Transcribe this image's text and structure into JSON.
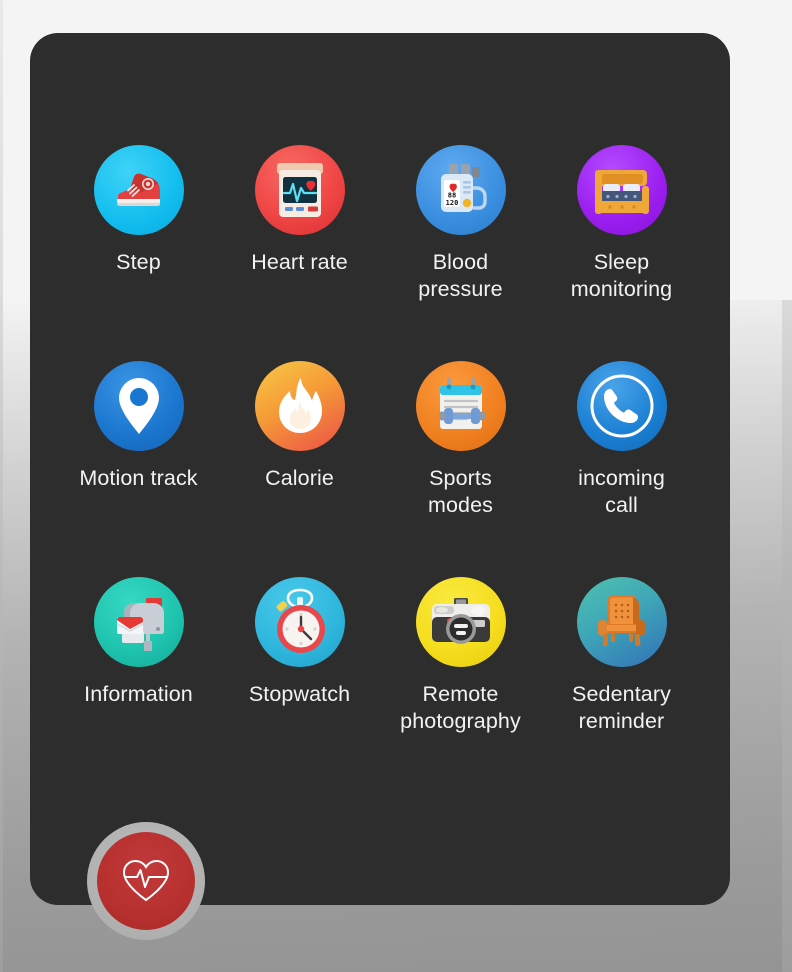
{
  "screen": {
    "background_color": "#2d2d2d",
    "page_background_color": "#f4f4f5"
  },
  "grid": {
    "items": [
      {
        "label": "Step",
        "icon": "sneaker-icon",
        "circle_color": "#1fc3f0"
      },
      {
        "label": "Heart rate",
        "icon": "heart-rate-monitor-icon",
        "circle_color": "#ef4444"
      },
      {
        "label": "Blood\npressure",
        "icon": "blood-pressure-cuff-icon",
        "circle_color": "#3b8fe0",
        "display_values": [
          "88",
          "120"
        ]
      },
      {
        "label": "Sleep\nmonitoring",
        "icon": "bed-icon",
        "circle_color": "#9b1ff0"
      },
      {
        "label": "Motion track",
        "icon": "location-pin-icon",
        "circle_color": "#1b76cf"
      },
      {
        "label": "Calorie",
        "icon": "flame-icon",
        "circle_color": "#f2a73b"
      },
      {
        "label": "Sports\nmodes",
        "icon": "calendar-dumbbell-icon",
        "circle_color": "#f08020"
      },
      {
        "label": "incoming\ncall",
        "icon": "phone-handset-icon",
        "circle_color": "#1b7fd4"
      },
      {
        "label": "Information",
        "icon": "mailbox-icon",
        "circle_color": "#1ec3ae"
      },
      {
        "label": "Stopwatch",
        "icon": "stopwatch-icon",
        "circle_color": "#2fb6dd"
      },
      {
        "label": "Remote\nphotography",
        "icon": "camera-icon",
        "circle_color": "#f5dd1e"
      },
      {
        "label": "Sedentary\nreminder",
        "icon": "armchair-icon",
        "circle_color": "#3f9ab0"
      }
    ]
  },
  "home_button": {
    "name": "heart-pulse-home-button",
    "color": "#b8312f"
  }
}
